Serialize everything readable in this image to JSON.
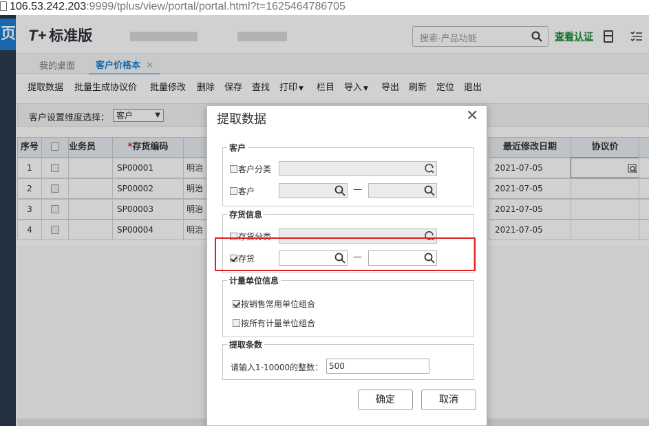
{
  "browser": {
    "url_host": "106.53.242.203",
    "url_rest": ":9999/tplus/view/portal/portal.html?t=1625464786705"
  },
  "left_strip": {
    "glyph": "页"
  },
  "header": {
    "logo_mark": "T+",
    "logo_text": "标准版",
    "search_placeholder": "搜索-产品功能",
    "cert_link": "查看认证"
  },
  "tabs": [
    {
      "label": "我的桌面"
    },
    {
      "label": "客户价格本",
      "close": "✕"
    }
  ],
  "toolbar": {
    "items": [
      "提取数据",
      "批量生成协议价",
      "批量修改",
      "删除",
      "保存",
      "查找",
      "打印",
      "栏目",
      "导入",
      "导出",
      "刷新",
      "定位",
      "退出"
    ]
  },
  "filter": {
    "label": "客户设置维度选择：",
    "value": "客户"
  },
  "grid": {
    "headers": {
      "seq": "序号",
      "salesman": "业务员",
      "code": "存货编码",
      "modified": "最近修改日期",
      "price": "协议价"
    },
    "rows": [
      {
        "seq": "1",
        "code": "SP00001",
        "name": "明治",
        "date": "2021-07-05"
      },
      {
        "seq": "2",
        "code": "SP00002",
        "name": "明治",
        "date": "2021-07-05"
      },
      {
        "seq": "3",
        "code": "SP00003",
        "name": "明治",
        "date": "2021-07-05"
      },
      {
        "seq": "4",
        "code": "SP00004",
        "name": "明治",
        "date": "2021-07-05"
      }
    ]
  },
  "dialog": {
    "title": "提取数据",
    "customer_group": "客户",
    "customer_class": "客户分类",
    "customer": "客户",
    "inventory_group": "存货信息",
    "inventory_class": "存货分类",
    "inventory": "存货",
    "unit_group": "计量单位信息",
    "unit_option1": "按销售常用单位组合",
    "unit_option2": "按所有计量单位组合",
    "count_group": "提取条数",
    "count_label": "请输入1-10000的整数：",
    "count_value": "500",
    "range_dash": "—",
    "ok": "确定",
    "cancel": "取消"
  },
  "colors": {
    "accent": "#1d7fd6",
    "highlight": "#e02020",
    "cert": "#1a8a3a"
  }
}
